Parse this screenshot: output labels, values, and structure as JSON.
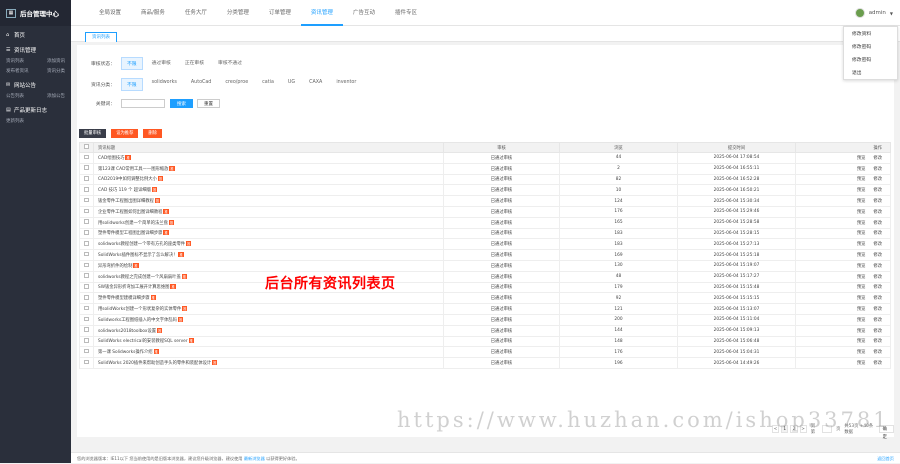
{
  "sidebar": {
    "logo_text": "后台管理中心",
    "sections": [
      {
        "label": "首页",
        "icon": "home-icon",
        "items": []
      },
      {
        "label": "资讯管理",
        "icon": "news-icon",
        "items": [
          [
            "资讯列表",
            "添加资讯"
          ],
          [
            "发布者资讯",
            "资讯分类"
          ]
        ]
      },
      {
        "label": "网站公告",
        "icon": "notice-icon",
        "items": [
          [
            "公告列表",
            "添加公告"
          ]
        ]
      },
      {
        "label": "产品更新日志",
        "icon": "log-icon",
        "items": [
          [
            "更新列表",
            ""
          ]
        ]
      }
    ]
  },
  "topnav": [
    "全局设置",
    "商品/服务",
    "任务大厅",
    "分类管理",
    "订单管理",
    "资讯管理",
    "广告互动",
    "插件专区"
  ],
  "topnav_active": 5,
  "user": {
    "name": "admin"
  },
  "user_menu": [
    "修改资料",
    "修改密码",
    "修改密码",
    "退出"
  ],
  "tab": {
    "label": "资讯列表"
  },
  "filters": {
    "status_label": "审核状态：",
    "status_options": [
      "不限",
      "通过审核",
      "正在审核",
      "审核不通过"
    ],
    "category_label": "资讯分类：",
    "category_options": [
      "不限",
      "solidworks",
      "AutoCad",
      "creo/proe",
      "catia",
      "UG",
      "CAXA",
      "inventor"
    ],
    "keyword_label": "关键词：",
    "keyword_value": "",
    "search_btn": "搜索",
    "reset_btn": "重置"
  },
  "actions": {
    "batch": "批量审核",
    "recommend": "设为推荐",
    "delete": "删除"
  },
  "table": {
    "headers": [
      "资讯标题",
      "审核",
      "浏览",
      "提交时间",
      "操作"
    ],
    "status_text": "已通过审核",
    "ops": [
      "预览",
      "修改"
    ],
    "tag": "推",
    "rows": [
      {
        "title": "CAD绘图技巧",
        "views": "44",
        "time": "2025-06-04 17:08:54"
      },
      {
        "title": "第123课 CAD常用工具——图形缩放",
        "views": "2",
        "time": "2025-06-04 16:55:11"
      },
      {
        "title": "CAD2019中如何调整比例大小",
        "views": "82",
        "time": "2025-06-04 16:52:28"
      },
      {
        "title": "CAD 技巧 119 个 超详细版",
        "views": "10",
        "time": "2025-06-04 16:50:21"
      },
      {
        "title": "钣金零件工程图出图详细教程",
        "views": "124",
        "time": "2025-06-04 15:30:34"
      },
      {
        "title": "企业零件工程图如何出图详细教程",
        "views": "176",
        "time": "2025-06-04 15:29:46"
      },
      {
        "title": "用solidworks创建一个简单的法兰盘",
        "views": "165",
        "time": "2025-06-04 15:28:58"
      },
      {
        "title": "塑件零件模型工程图出图详细步骤",
        "views": "183",
        "time": "2025-06-04 15:28:15"
      },
      {
        "title": "solidworks教程创建一个带有方孔的座类零件",
        "views": "183",
        "time": "2025-06-04 15:27:13"
      },
      {
        "title": "SolidWorks插件图标不显示了怎么解决！",
        "views": "169",
        "time": "2025-06-04 15:25:18"
      },
      {
        "title": "异形弯折件的绘制",
        "views": "130",
        "time": "2025-06-04 15:19:07"
      },
      {
        "title": "solidworks教程之完成创建一个风扇扇叶盖",
        "views": "48",
        "time": "2025-06-04 15:17:27"
      },
      {
        "title": "SW钣金异形折弯加工展开计算思维图",
        "views": "179",
        "time": "2025-06-04 15:15:48"
      },
      {
        "title": "塑件零件模型建模详细步骤",
        "views": "92",
        "time": "2025-06-04 15:15:15"
      },
      {
        "title": "用solidWorks创建一个形状复杂的实体零件",
        "views": "121",
        "time": "2025-06-04 15:13:07"
      },
      {
        "title": "Solidworks工程图纸插入的中文字体乱码",
        "views": "200",
        "time": "2025-06-04 15:11:04"
      },
      {
        "title": "solidworks2018toolbox设置",
        "views": "144",
        "time": "2025-06-04 15:09:13"
      },
      {
        "title": "SolidWorks electrical的安装教程SQL server",
        "views": "148",
        "time": "2025-06-04 15:06:48"
      },
      {
        "title": "第一课 Solidworks操作介绍",
        "views": "176",
        "time": "2025-06-04 15:04:31"
      },
      {
        "title": "SolidWorks 2020插件来帮助创造手头的零件和装配体设计",
        "views": "196",
        "time": "2025-06-04 14:49:26"
      }
    ]
  },
  "watermark": "后台所有资讯列表页",
  "pager": {
    "prev": "<",
    "pages": [
      "1",
      "2"
    ],
    "current": "1",
    "next": ">",
    "goto_label": "到第",
    "page_unit": "页",
    "total_text": "共53页 +40条数据",
    "go_btn": "确定"
  },
  "footer": {
    "text": "您的浏览器版本：IE11以下 您当前使用的是旧版本浏览器，建议您升级浏览器，建议使用",
    "link": "最新浏览器",
    "tail": "以获得更好体验。",
    "right": "返回首页"
  },
  "url_watermark": "https://www.huzhan.com/ishop33781"
}
